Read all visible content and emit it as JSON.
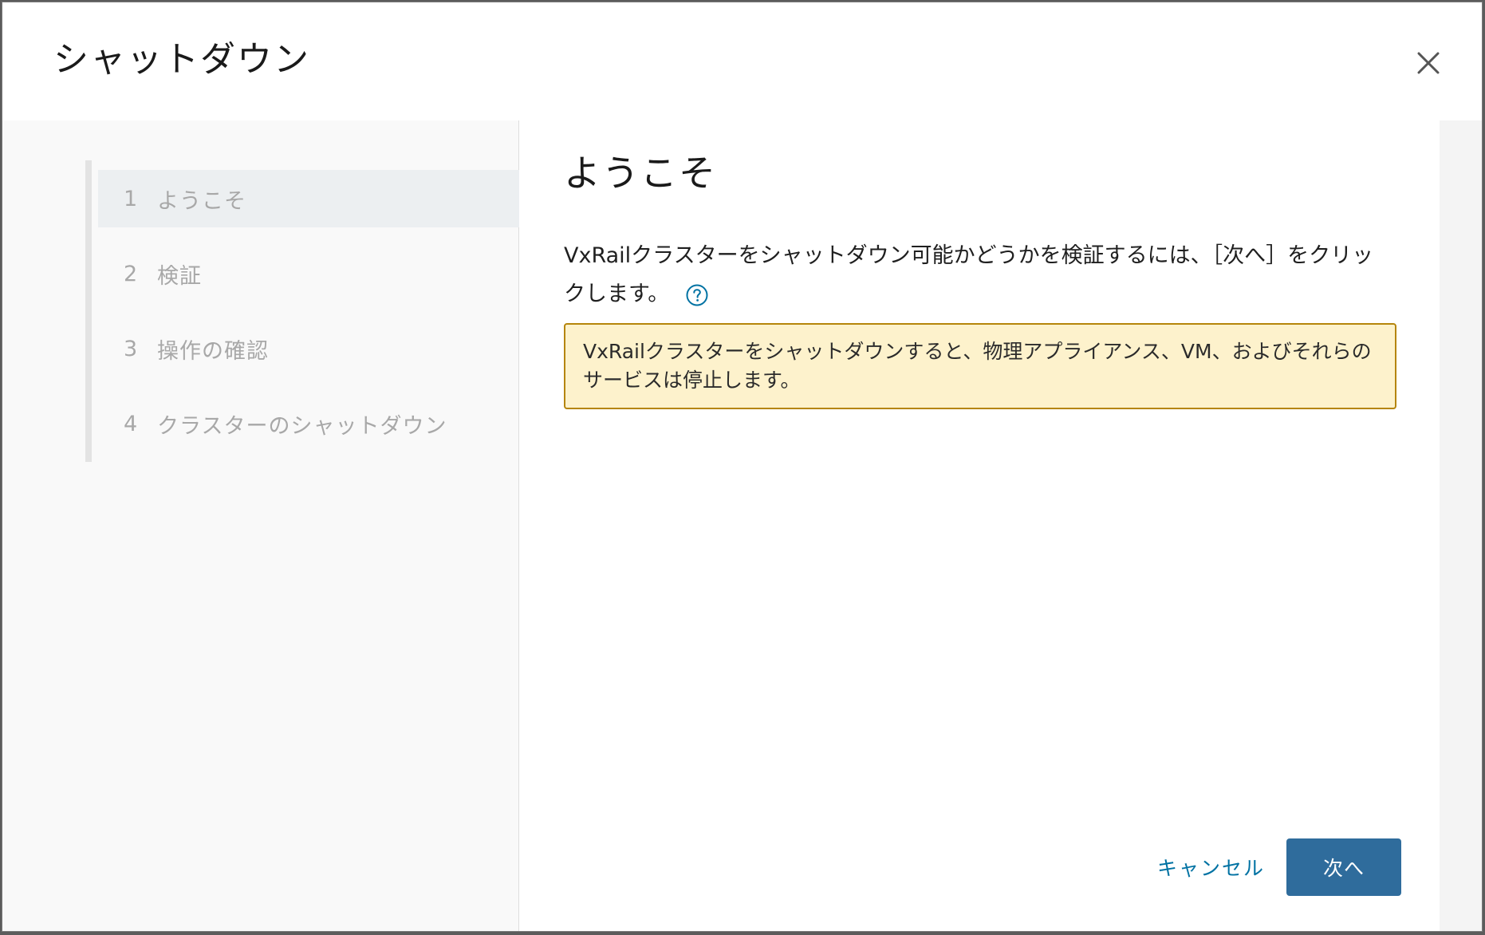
{
  "dialog": {
    "title": "シャットダウン",
    "close_icon": "close-icon"
  },
  "wizard": {
    "steps": [
      {
        "number": "1",
        "label": "ようこそ",
        "active": true
      },
      {
        "number": "2",
        "label": "検証",
        "active": false
      },
      {
        "number": "3",
        "label": "操作の確認",
        "active": false
      },
      {
        "number": "4",
        "label": "クラスターのシャットダウン",
        "active": false
      }
    ]
  },
  "main": {
    "heading": "ようこそ",
    "description": "VxRailクラスターをシャットダウン可能かどうかを検証するには、［次へ］をクリックします。",
    "help_icon": "help-circle-icon",
    "warning": "VxRailクラスターをシャットダウンすると、物理アプライアンス、VM、およびそれらのサービスは停止します。"
  },
  "footer": {
    "cancel_label": "キャンセル",
    "next_label": "次へ"
  },
  "colors": {
    "primary_button": "#2f6c9c",
    "link": "#0072a3",
    "warning_bg": "#fdf2cc",
    "warning_border": "#b5850b"
  }
}
